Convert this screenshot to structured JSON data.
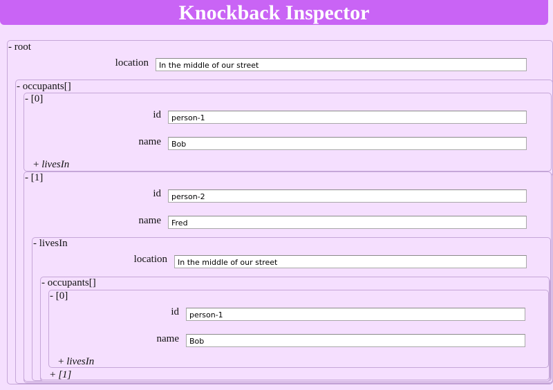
{
  "app": {
    "title": "Knockback Inspector"
  },
  "root": {
    "toggle": "- root",
    "location": {
      "label": "location",
      "value": "In the middle of our street"
    },
    "occupants": {
      "toggle": "- occupants[]",
      "item0": {
        "toggle": "- [0]",
        "id": {
          "label": "id",
          "value": "person-1"
        },
        "name": {
          "label": "name",
          "value": "Bob"
        },
        "livesIn": {
          "plus": "+ ",
          "label": "livesIn"
        }
      },
      "item1": {
        "toggle": "- [1]",
        "id": {
          "label": "id",
          "value": "person-2"
        },
        "name": {
          "label": "name",
          "value": "Fred"
        },
        "livesIn": {
          "toggle": "- livesIn",
          "location": {
            "label": "location",
            "value": "In the middle of our street"
          },
          "occupants": {
            "toggle": "- occupants[]",
            "item0": {
              "toggle": "- [0]",
              "id": {
                "label": "id",
                "value": "person-1"
              },
              "name": {
                "label": "name",
                "value": "Bob"
              },
              "livesIn": {
                "plus": "+ ",
                "label": "livesIn"
              }
            },
            "item1": {
              "plus": "+ ",
              "label": "[1]"
            }
          }
        }
      }
    }
  }
}
